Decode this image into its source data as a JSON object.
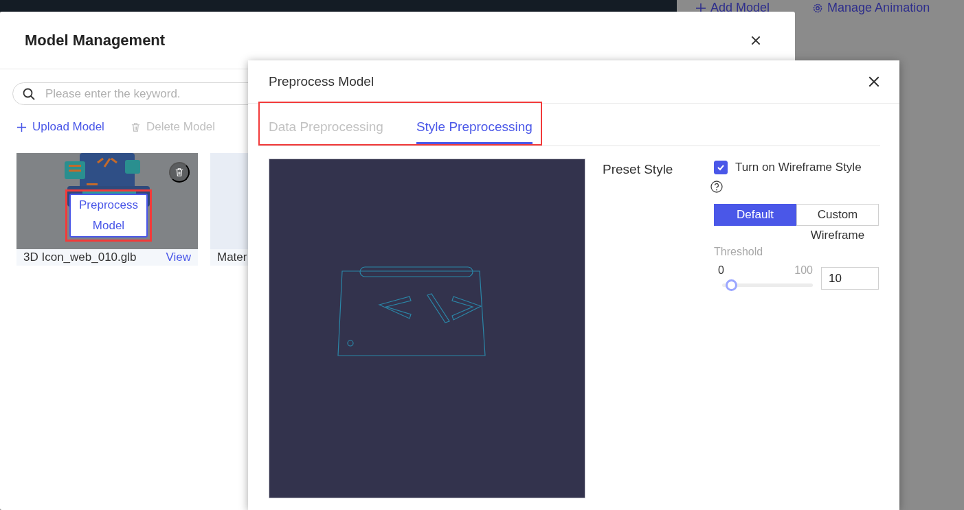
{
  "background": {
    "links": [
      {
        "kind": "add",
        "label": "Add Model"
      },
      {
        "kind": "gear",
        "label": "Manage Animation"
      }
    ]
  },
  "model_dialog": {
    "title": "Model Management",
    "search": {
      "placeholder": "Please enter the keyword."
    },
    "actions": [
      {
        "kind": "add",
        "label": "Upload Model",
        "disabled": false
      },
      {
        "kind": "delete",
        "label": "Delete Model",
        "disabled": true
      }
    ],
    "cards": [
      {
        "kind": "picture",
        "name": "3D Icon_web_010.glb",
        "link": "View",
        "overlay_button": "Preprocess Model",
        "highlighted": true
      },
      {
        "kind": "blank",
        "name": "Mater"
      }
    ]
  },
  "preprocess_dialog": {
    "title": "Preprocess Model",
    "tabs_highlighted": true,
    "tabs": [
      {
        "label": "Data Preprocessing",
        "selected": false
      },
      {
        "label": "Style Preprocessing",
        "selected": true
      }
    ],
    "preset_style": {
      "label": "Preset Style",
      "wireframe": {
        "label": "Turn on Wireframe Style",
        "checked": true
      },
      "modes": [
        {
          "label": "Default",
          "selected": true
        },
        {
          "label": "Custom Wireframe",
          "selected": false
        }
      ],
      "threshold": {
        "label": "Threshold",
        "min": "0",
        "max": "100",
        "level": 0.1,
        "value": "10"
      }
    }
  }
}
